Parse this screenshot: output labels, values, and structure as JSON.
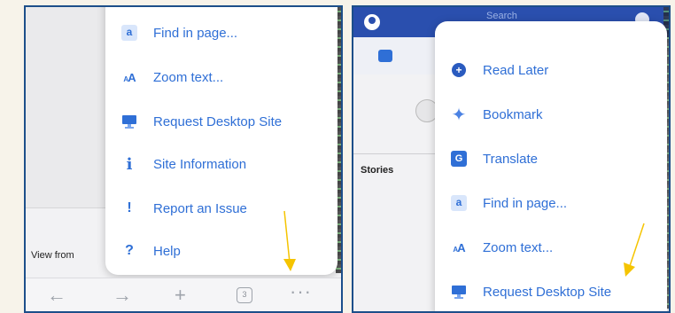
{
  "left": {
    "menu_items": [
      {
        "icon": "find-in-page-icon",
        "label": "Find in page..."
      },
      {
        "icon": "zoom-text-icon",
        "label": "Zoom text..."
      },
      {
        "icon": "desktop-site-icon",
        "label": "Request Desktop Site"
      },
      {
        "icon": "info-icon",
        "label": "Site Information"
      },
      {
        "icon": "report-icon",
        "label": "Report an Issue"
      },
      {
        "icon": "help-icon",
        "label": "Help"
      }
    ],
    "background_text": "View from",
    "tab_count": "3"
  },
  "right": {
    "search_placeholder": "Search",
    "stories_label": "Stories",
    "menu_items": [
      {
        "icon": "read-later-icon",
        "label": "Read Later"
      },
      {
        "icon": "bookmark-icon",
        "label": "Bookmark"
      },
      {
        "icon": "translate-icon",
        "label": "Translate"
      },
      {
        "icon": "find-in-page-icon",
        "label": "Find in page..."
      },
      {
        "icon": "zoom-text-icon",
        "label": "Zoom text..."
      },
      {
        "icon": "desktop-site-icon",
        "label": "Request Desktop Site"
      }
    ]
  },
  "colors": {
    "accent": "#2f6fd6",
    "header": "#2a4fae",
    "arrow": "#f5c400",
    "border": "#1d4f8a"
  }
}
